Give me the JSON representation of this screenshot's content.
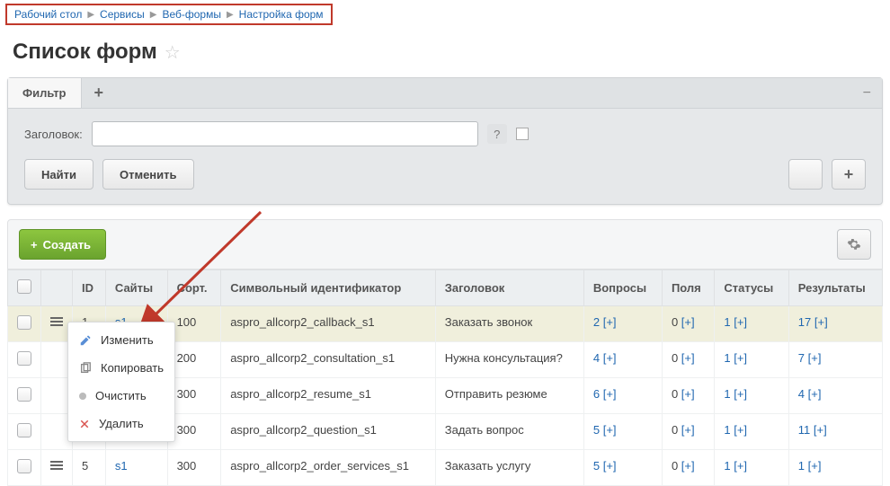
{
  "breadcrumbs": {
    "items": [
      "Рабочий стол",
      "Сервисы",
      "Веб-формы",
      "Настройка форм"
    ]
  },
  "page": {
    "title": "Список форм"
  },
  "filter": {
    "tab": "Фильтр",
    "label": "Заголовок:",
    "value": "",
    "find": "Найти",
    "cancel": "Отменить"
  },
  "toolbar": {
    "create": "Создать"
  },
  "columns": {
    "id": "ID",
    "sites": "Сайты",
    "sort": "Сорт.",
    "sid": "Символьный идентификатор",
    "header": "Заголовок",
    "questions": "Вопросы",
    "fields": "Поля",
    "statuses": "Статусы",
    "results": "Результаты"
  },
  "rows": [
    {
      "id": "1",
      "site": "s1",
      "sort": "100",
      "sid": "aspro_allcorp2_callback_s1",
      "title": "Заказать звонок",
      "q": "2",
      "f": "0",
      "st": "1",
      "res": "17"
    },
    {
      "id": "",
      "site": "",
      "sort": "200",
      "sid": "aspro_allcorp2_consultation_s1",
      "title": "Нужна консультация?",
      "q": "4",
      "f": "0",
      "st": "1",
      "res": "7"
    },
    {
      "id": "",
      "site": "",
      "sort": "300",
      "sid": "aspro_allcorp2_resume_s1",
      "title": "Отправить резюме",
      "q": "6",
      "f": "0",
      "st": "1",
      "res": "4"
    },
    {
      "id": "",
      "site": "",
      "sort": "300",
      "sid": "aspro_allcorp2_question_s1",
      "title": "Задать вопрос",
      "q": "5",
      "f": "0",
      "st": "1",
      "res": "11"
    },
    {
      "id": "5",
      "site": "s1",
      "sort": "300",
      "sid": "aspro_allcorp2_order_services_s1",
      "title": "Заказать услугу",
      "q": "5",
      "f": "0",
      "st": "1",
      "res": "1"
    }
  ],
  "plus": "[+]",
  "menu": {
    "edit": "Изменить",
    "copy": "Копировать",
    "clear": "Очистить",
    "del": "Удалить"
  }
}
